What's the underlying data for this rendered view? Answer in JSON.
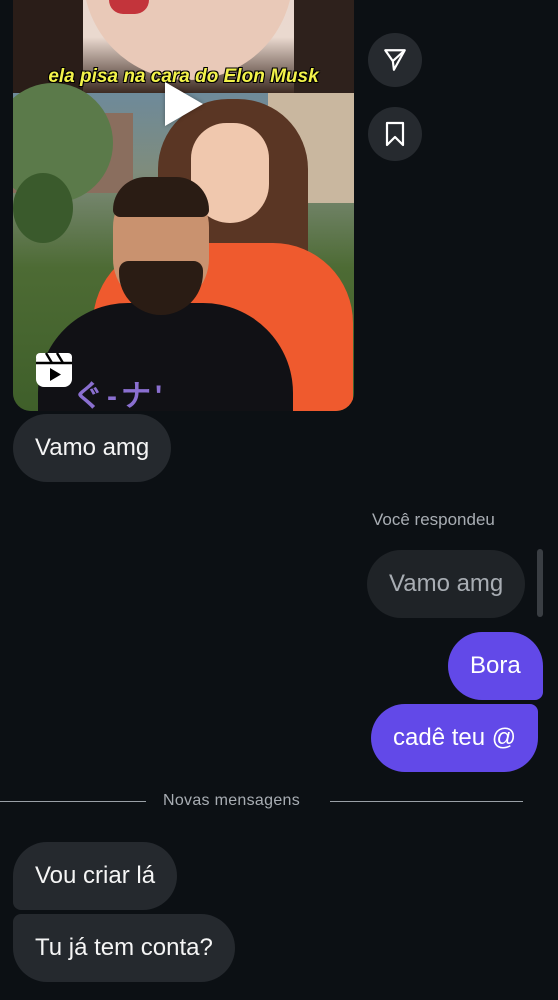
{
  "reel": {
    "caption": "ela pisa na cara do Elon Musk",
    "shirt_text": "ぐ-ナ'"
  },
  "side_actions": {
    "share_icon": "paper-plane-icon",
    "save_icon": "bookmark-icon"
  },
  "messages": {
    "m1": "Vamo amg",
    "replied_label": "Você respondeu",
    "replied_quote": "Vamo amg",
    "m2": "Bora",
    "m3": "cadê teu @",
    "new_messages_label": "Novas mensagens",
    "m4": "Vou criar lá",
    "m5": "Tu já tem conta?"
  },
  "colors": {
    "background": "#0c1014",
    "incoming_bubble": "#25292e",
    "outgoing_bubble": "#6249e8"
  }
}
